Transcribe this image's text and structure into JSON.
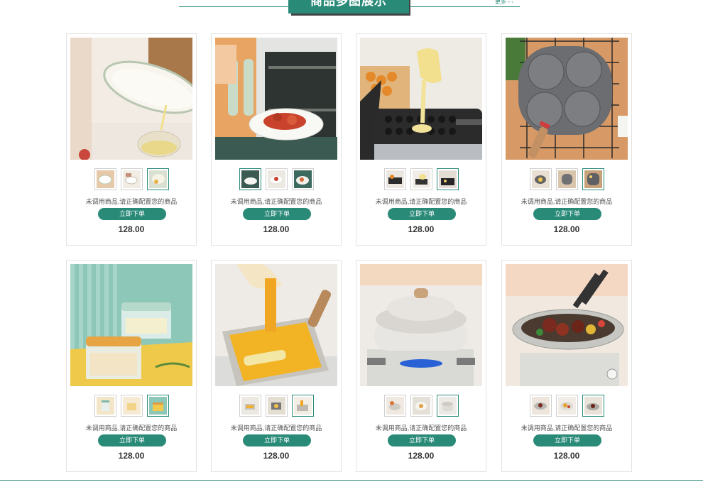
{
  "header": {
    "title": "商品多图展示",
    "more": "更多 ◦ ◦"
  },
  "colors": {
    "accent": "#2a8a78",
    "border": "#e2e2e2",
    "text": "#555555",
    "price": "#333333"
  },
  "products": [
    {
      "name_note": "未调用商品,请正确配置您的商品",
      "buy_label": "立即下单",
      "price": "128.00"
    },
    {
      "name_note": "未调用商品,请正确配置您的商品",
      "buy_label": "立即下单",
      "price": "128.00"
    },
    {
      "name_note": "未调用商品,请正确配置您的商品",
      "buy_label": "立即下单",
      "price": "128.00"
    },
    {
      "name_note": "未调用商品,请正确配置您的商品",
      "buy_label": "立即下单",
      "price": "128.00"
    },
    {
      "name_note": "未调用商品,请正确配置您的商品",
      "buy_label": "立即下单",
      "price": "128.00"
    },
    {
      "name_note": "未调用商品,请正确配置您的商品",
      "buy_label": "立即下单",
      "price": "128.00"
    },
    {
      "name_note": "未调用商品,请正确配置您的商品",
      "buy_label": "立即下单",
      "price": "128.00"
    },
    {
      "name_note": "未调用商品,请正确配置您的商品",
      "buy_label": "立即下单",
      "price": "128.00"
    }
  ]
}
